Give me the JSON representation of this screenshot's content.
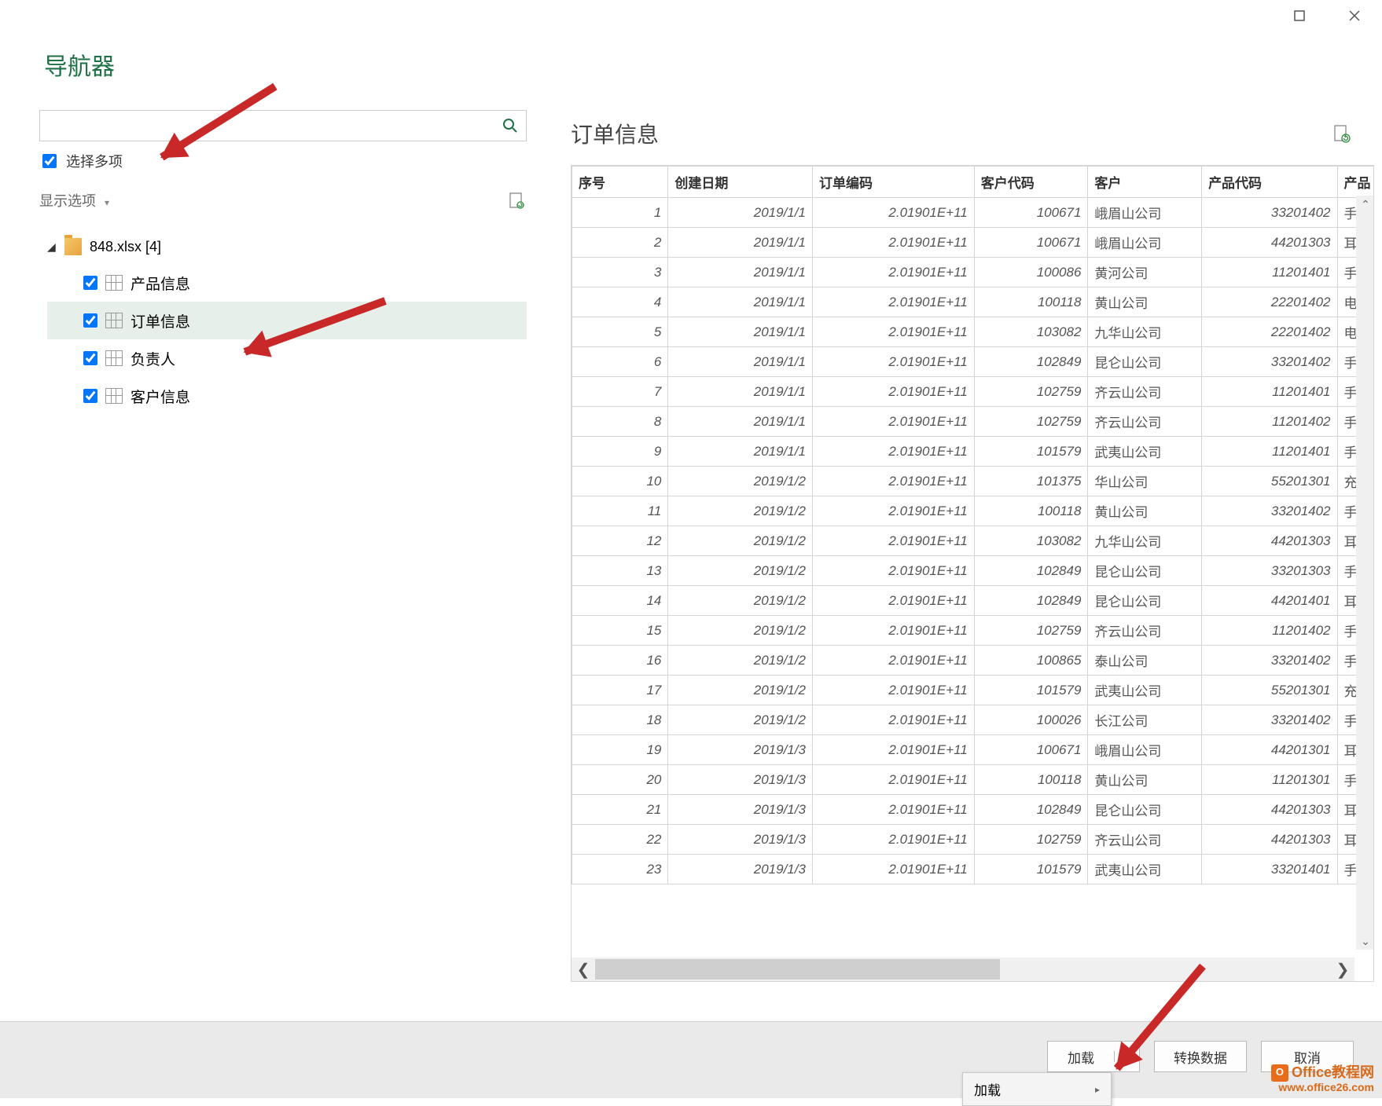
{
  "window_title": "导航器",
  "multi_select_label": "选择多项",
  "multi_select_checked": true,
  "display_options_label": "显示选项",
  "tree_root": "848.xlsx [4]",
  "tree_items": [
    {
      "label": "产品信息",
      "checked": true,
      "selected": false
    },
    {
      "label": "订单信息",
      "checked": true,
      "selected": true
    },
    {
      "label": "负责人",
      "checked": true,
      "selected": false
    },
    {
      "label": "客户信息",
      "checked": true,
      "selected": false
    }
  ],
  "preview_title": "订单信息",
  "columns": [
    "序号",
    "创建日期",
    "订单编码",
    "客户代码",
    "客户",
    "产品代码",
    "产品"
  ],
  "rows": [
    [
      "1",
      "2019/1/1",
      "2.01901E+11",
      "100671",
      "峨眉山公司",
      "33201402",
      "手"
    ],
    [
      "2",
      "2019/1/1",
      "2.01901E+11",
      "100671",
      "峨眉山公司",
      "44201303",
      "耳"
    ],
    [
      "3",
      "2019/1/1",
      "2.01901E+11",
      "100086",
      "黄河公司",
      "11201401",
      "手"
    ],
    [
      "4",
      "2019/1/1",
      "2.01901E+11",
      "100118",
      "黄山公司",
      "22201402",
      "电"
    ],
    [
      "5",
      "2019/1/1",
      "2.01901E+11",
      "103082",
      "九华山公司",
      "22201402",
      "电"
    ],
    [
      "6",
      "2019/1/1",
      "2.01901E+11",
      "102849",
      "昆仑山公司",
      "33201402",
      "手"
    ],
    [
      "7",
      "2019/1/1",
      "2.01901E+11",
      "102759",
      "齐云山公司",
      "11201401",
      "手"
    ],
    [
      "8",
      "2019/1/1",
      "2.01901E+11",
      "102759",
      "齐云山公司",
      "11201402",
      "手"
    ],
    [
      "9",
      "2019/1/1",
      "2.01901E+11",
      "101579",
      "武夷山公司",
      "11201401",
      "手"
    ],
    [
      "10",
      "2019/1/2",
      "2.01901E+11",
      "101375",
      "华山公司",
      "55201301",
      "充"
    ],
    [
      "11",
      "2019/1/2",
      "2.01901E+11",
      "100118",
      "黄山公司",
      "33201402",
      "手"
    ],
    [
      "12",
      "2019/1/2",
      "2.01901E+11",
      "103082",
      "九华山公司",
      "44201303",
      "耳"
    ],
    [
      "13",
      "2019/1/2",
      "2.01901E+11",
      "102849",
      "昆仑山公司",
      "33201303",
      "手"
    ],
    [
      "14",
      "2019/1/2",
      "2.01901E+11",
      "102849",
      "昆仑山公司",
      "44201401",
      "耳"
    ],
    [
      "15",
      "2019/1/2",
      "2.01901E+11",
      "102759",
      "齐云山公司",
      "11201402",
      "手"
    ],
    [
      "16",
      "2019/1/2",
      "2.01901E+11",
      "100865",
      "泰山公司",
      "33201402",
      "手"
    ],
    [
      "17",
      "2019/1/2",
      "2.01901E+11",
      "101579",
      "武夷山公司",
      "55201301",
      "充"
    ],
    [
      "18",
      "2019/1/2",
      "2.01901E+11",
      "100026",
      "长江公司",
      "33201402",
      "手"
    ],
    [
      "19",
      "2019/1/3",
      "2.01901E+11",
      "100671",
      "峨眉山公司",
      "44201301",
      "耳"
    ],
    [
      "20",
      "2019/1/3",
      "2.01901E+11",
      "100118",
      "黄山公司",
      "11201301",
      "手"
    ],
    [
      "21",
      "2019/1/3",
      "2.01901E+11",
      "102849",
      "昆仑山公司",
      "44201303",
      "耳"
    ],
    [
      "22",
      "2019/1/3",
      "2.01901E+11",
      "102759",
      "齐云山公司",
      "44201303",
      "耳"
    ],
    [
      "23",
      "2019/1/3",
      "2.01901E+11",
      "101579",
      "武夷山公司",
      "33201401",
      "手"
    ]
  ],
  "footer": {
    "load": "加载",
    "transform": "转换数据",
    "cancel": "取消",
    "menu_load": "加载"
  },
  "watermark": {
    "title": "Office教程网",
    "sub": "www.office26.com"
  }
}
